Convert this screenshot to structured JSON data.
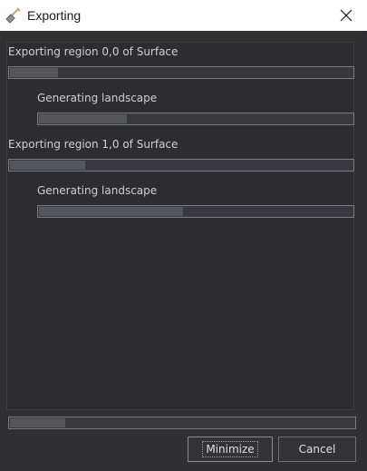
{
  "window": {
    "title": "Exporting",
    "close_label": "×"
  },
  "regions": [
    {
      "label": "Exporting region 0,0 of Surface",
      "progress": 0.14,
      "sub_label": "Generating landscape",
      "sub_progress": 0.28
    },
    {
      "label": "Exporting region 1,0 of Surface",
      "progress": 0.22,
      "sub_label": "Generating landscape",
      "sub_progress": 0.46
    }
  ],
  "overall_progress": 0.16,
  "buttons": {
    "minimize": "Minimize",
    "cancel": "Cancel"
  },
  "icons": {
    "app": "shovel-icon",
    "close": "close-icon"
  }
}
